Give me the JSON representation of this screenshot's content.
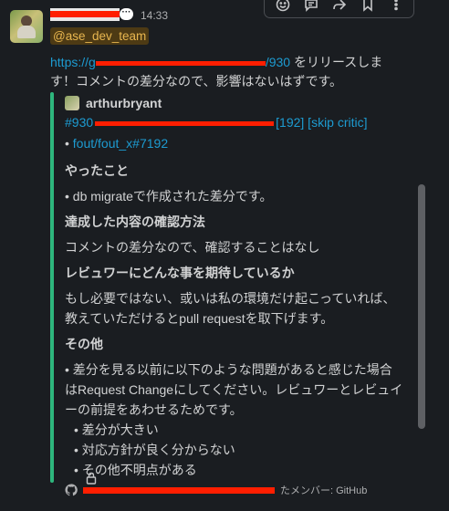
{
  "message": {
    "timestamp": "14:33",
    "mention": "@ase_dev_team",
    "link_prefix": "https://g",
    "link_suffix": "/930",
    "text_line1": " をリリースしま",
    "text_line2": "す！コメントの差分なので、影響はないはずです。"
  },
  "attachment": {
    "author": "arthurbryant",
    "title_prefix": "#930",
    "title_suffix": "192] [skip critic]",
    "sub_link": "fout/fout_x#7192",
    "sections": {
      "h1": "やったこと",
      "p1": "• db migrateで作成された差分です。",
      "h2": "達成した内容の確認方法",
      "p2": "コメントの差分なので、確認することはなし",
      "h3": "レビュワーにどんな事を期待しているか",
      "p3a": "もし必要ではない、或いは私の環境だけ起こっていれば、",
      "p3b": "教えていただけるとpull requestを取下げます。",
      "h4": "その他",
      "p4a": "• 差分を見る以前に以下のような問題があると感じた場合",
      "p4b": "はRequest Changeにしてください。レビュワーとレビュイ",
      "p4c": "ーの前提をあわせるためです。",
      "b1": "• 差分が大きい",
      "b2": "• 対応方針が良く分からない",
      "b3": "• その他不明点がある"
    },
    "footer_text": "たメンバー: GitHub"
  },
  "toolbar": {
    "icons": [
      "emoji-icon",
      "reply-thread-icon",
      "share-icon",
      "bookmark-icon",
      "more-icon"
    ]
  }
}
